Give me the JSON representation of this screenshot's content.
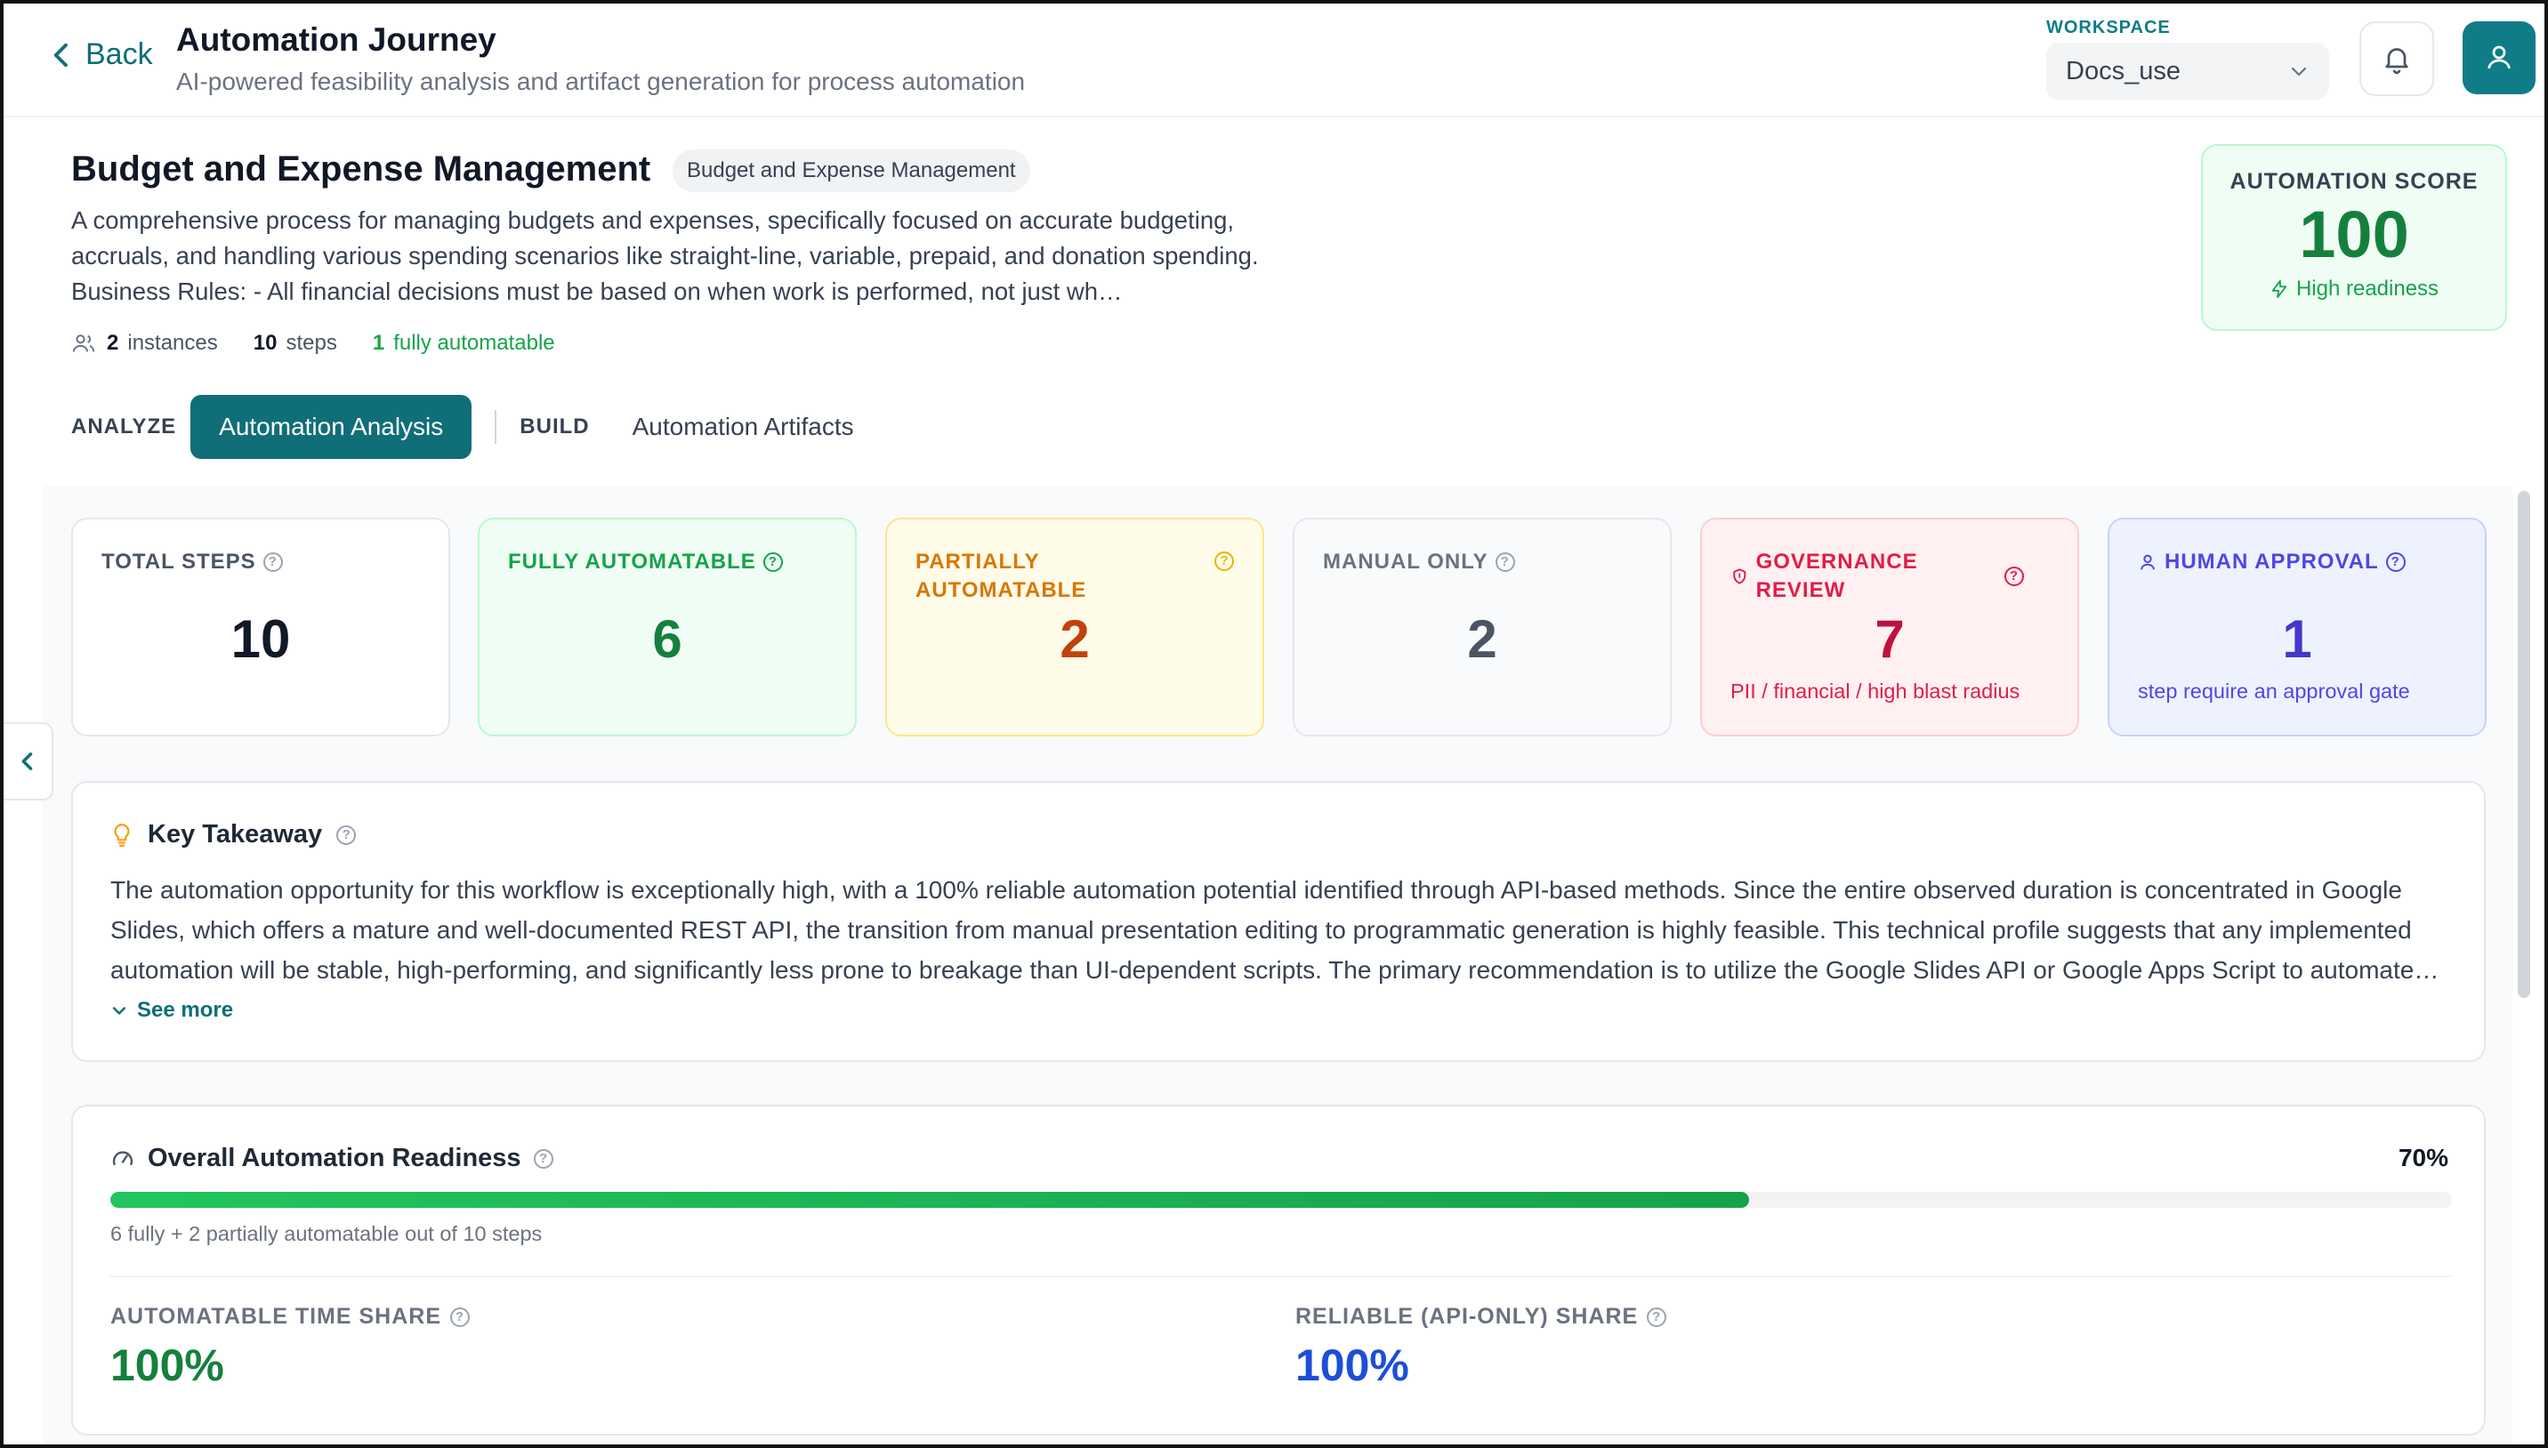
{
  "header": {
    "back_label": "Back",
    "title": "Automation Journey",
    "subtitle": "AI-powered feasibility analysis and artifact generation for process automation",
    "workspace_label": "WORKSPACE",
    "workspace_value": "Docs_use"
  },
  "process": {
    "title": "Budget and Expense Management",
    "tag": "Budget and Expense Management",
    "description": "A comprehensive process for managing budgets and expenses, specifically focused on accurate budgeting, accruals, and handling various spending scenarios like straight-line, variable, prepaid, and donation spending. Business Rules: - All financial decisions must be based on when work is performed, not just wh…",
    "instances_count": "2",
    "instances_label": "instances",
    "steps_count": "10",
    "steps_label": "steps",
    "automatable_count": "1",
    "automatable_label": "fully automatable"
  },
  "score": {
    "label": "AUTOMATION SCORE",
    "value": "100",
    "status": "High readiness"
  },
  "tabs": {
    "analyze_label": "ANALYZE",
    "analysis_tab": "Automation Analysis",
    "build_label": "BUILD",
    "artifacts_tab": "Automation Artifacts"
  },
  "stats": [
    {
      "label": "TOTAL STEPS",
      "value": "10",
      "sub": "",
      "color": "#111827",
      "label_color": "#4b5563",
      "bg": "#ffffff",
      "border": "#e5e7eb"
    },
    {
      "label": "FULLY AUTOMATABLE",
      "value": "6",
      "sub": "",
      "color": "#15803d",
      "label_color": "#16a34a",
      "bg": "#f0fdf4",
      "border": "#bbf7d0"
    },
    {
      "label": "PARTIALLY AUTOMATABLE",
      "value": "2",
      "sub": "",
      "color": "#c2410c",
      "label_color": "#d97706",
      "bg": "#fefce8",
      "border": "#fde68a"
    },
    {
      "label": "MANUAL ONLY",
      "value": "2",
      "sub": "",
      "color": "#4b5563",
      "label_color": "#6b7280",
      "bg": "#f9fafb",
      "border": "#e5e7eb"
    },
    {
      "label": "GOVERNANCE REVIEW",
      "value": "7",
      "sub": "PII / financial / high blast radius",
      "color": "#be123c",
      "label_color": "#e11d48",
      "bg": "#fff1f2",
      "border": "#fecdd3"
    },
    {
      "label": "HUMAN APPROVAL",
      "value": "1",
      "sub": "step require an approval gate",
      "color": "#4338ca",
      "label_color": "#4f46e5",
      "bg": "#eef2ff",
      "border": "#c7d2fe"
    }
  ],
  "takeaway": {
    "title": "Key Takeaway",
    "text": "The automation opportunity for this workflow is exceptionally high, with a 100% reliable automation potential identified through API-based methods. Since the entire observed duration is concentrated in Google Slides, which offers a mature and well-documented REST API, the transition from manual presentation editing to programmatic generation is highly feasible. This technical profile suggests that any implemented automation will be stable, high-performing, and significantly less prone to breakage than UI-dependent scripts. The primary recommendation is to utilize the Google Slides API or Google Apps Script to automate…",
    "see_more": "See more"
  },
  "readiness": {
    "title": "Overall Automation Readiness",
    "percent_label": "70%",
    "percent": 0.7,
    "note": "6 fully + 2 partially automatable out of 10 steps",
    "time_share_label": "AUTOMATABLE TIME SHARE",
    "time_share_value": "100%",
    "time_share_color": "#15803d",
    "api_share_label": "RELIABLE (API-ONLY) SHARE",
    "api_share_value": "100%",
    "api_share_color": "#1d4ed8"
  },
  "colors": {
    "accent": "#0f6e78",
    "success": "#16a34a"
  }
}
